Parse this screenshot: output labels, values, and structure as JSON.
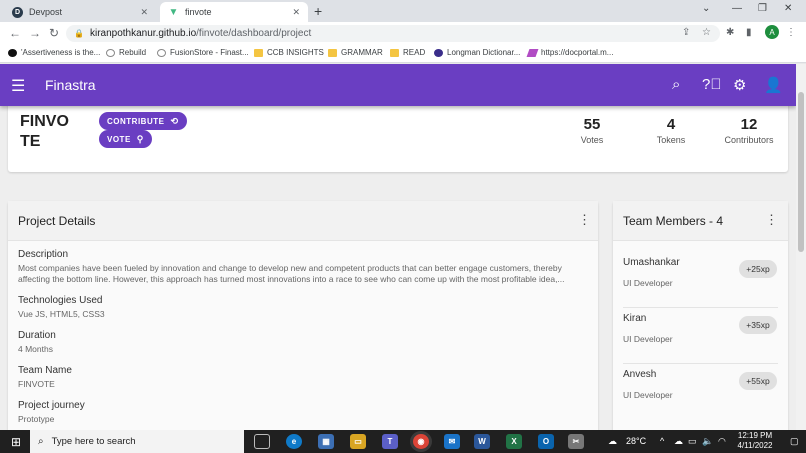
{
  "browser": {
    "tabs": [
      {
        "title": "Devpost",
        "favicon": "devpost-icon",
        "active": false
      },
      {
        "title": "finvote",
        "favicon": "vue-icon",
        "active": true
      }
    ],
    "url_host": "kiranpothkanur.github.io",
    "url_path": "/finvote/dashboard/project",
    "profile_initial": "A",
    "bookmarks": [
      {
        "label": "'Assertiveness is the...",
        "icon": "n-icon"
      },
      {
        "label": "Rebuild",
        "icon": "link-icon"
      },
      {
        "label": "FusionStore - Finast...",
        "icon": "fusion-icon"
      },
      {
        "label": "CCB INSIGHTS",
        "icon": "folder-icon"
      },
      {
        "label": "GRAMMAR",
        "icon": "folder-icon"
      },
      {
        "label": "READ",
        "icon": "folder-icon"
      },
      {
        "label": "Longman Dictionar...",
        "icon": "longman-icon"
      },
      {
        "label": "https://docportal.m...",
        "icon": "docportal-icon"
      }
    ]
  },
  "app": {
    "brand": "Finastra",
    "accent_color": "#6a3ec2"
  },
  "project": {
    "name_line1": "FINVO",
    "name_line2": "TE",
    "contribute_label": "CONTRIBUTE",
    "vote_label": "VOTE",
    "stats": [
      {
        "value": "55",
        "label": "Votes"
      },
      {
        "value": "4",
        "label": "Tokens"
      },
      {
        "value": "12",
        "label": "Contributors"
      }
    ]
  },
  "details": {
    "title": "Project Details",
    "fields": [
      {
        "label": "Description",
        "value": "Most companies have been fueled by innovation and change to develop new and competent products that can better engage customers, thereby affecting the bottom line. However, this approach has turned most innovations into a race to see who can come up with the most profitable idea,..."
      },
      {
        "label": "Technologies Used",
        "value": "Vue JS, HTML5, CSS3"
      },
      {
        "label": "Duration",
        "value": "4 Months"
      },
      {
        "label": "Team Name",
        "value": "FINVOTE"
      },
      {
        "label": "Project journey",
        "value": "Prototype"
      }
    ]
  },
  "team": {
    "title": "Team Members - 4",
    "members": [
      {
        "name": "Umashankar",
        "role": "UI Developer",
        "xp": "+25xp"
      },
      {
        "name": "Kiran",
        "role": "UI Developer",
        "xp": "+35xp"
      },
      {
        "name": "Anvesh",
        "role": "UI Developer",
        "xp": "+55xp"
      }
    ]
  },
  "taskbar": {
    "search_placeholder": "Type here to search",
    "temperature": "28°C",
    "time": "12:19 PM",
    "date": "4/11/2022"
  }
}
